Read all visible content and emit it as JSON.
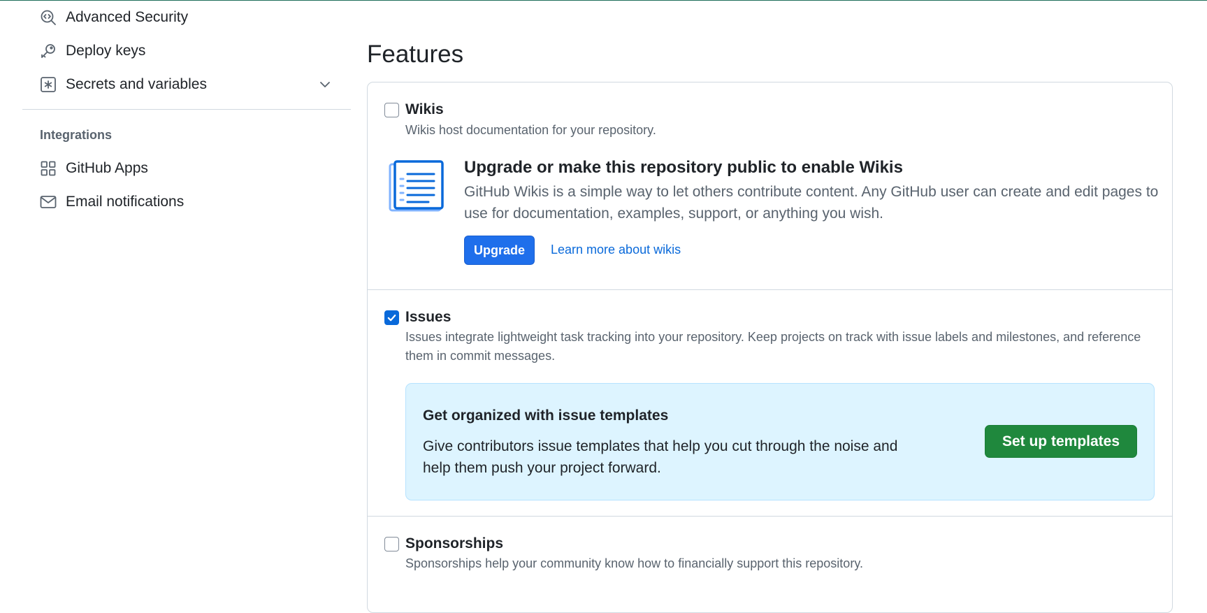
{
  "sidebar": {
    "items": [
      {
        "label": "Advanced Security",
        "icon": "codescan-icon"
      },
      {
        "label": "Deploy keys",
        "icon": "key-icon"
      },
      {
        "label": "Secrets and variables",
        "icon": "asterisk-icon"
      }
    ],
    "integrations_heading": "Integrations",
    "integration_items": [
      {
        "label": "GitHub Apps",
        "icon": "apps-icon"
      },
      {
        "label": "Email notifications",
        "icon": "mail-icon"
      }
    ]
  },
  "main": {
    "title": "Features",
    "wikis": {
      "label": "Wikis",
      "checked": false,
      "description": "Wikis host documentation for your repository.",
      "upsell_title": "Upgrade or make this repository public to enable Wikis",
      "upsell_text": "GitHub Wikis is a simple way to let others contribute content. Any GitHub user can create and edit pages to use for documentation, examples, support, or anything you wish.",
      "upgrade_button": "Upgrade",
      "learn_more_link": "Learn more about wikis"
    },
    "issues": {
      "label": "Issues",
      "checked": true,
      "description": "Issues integrate lightweight task tracking into your repository. Keep projects on track with issue labels and milestones, and reference them in commit messages.",
      "templates_title": "Get organized with issue templates",
      "templates_text": "Give contributors issue templates that help you cut through the noise and help them push your project forward.",
      "templates_button": "Set up templates"
    },
    "sponsorships": {
      "label": "Sponsorships",
      "checked": false,
      "description": "Sponsorships help your community know how to financially support this repository."
    }
  },
  "colors": {
    "accent": "#0969da",
    "primary_button": "#1f883d",
    "upgrade_button": "#1f6feb",
    "info_box": "#ddf4ff"
  }
}
